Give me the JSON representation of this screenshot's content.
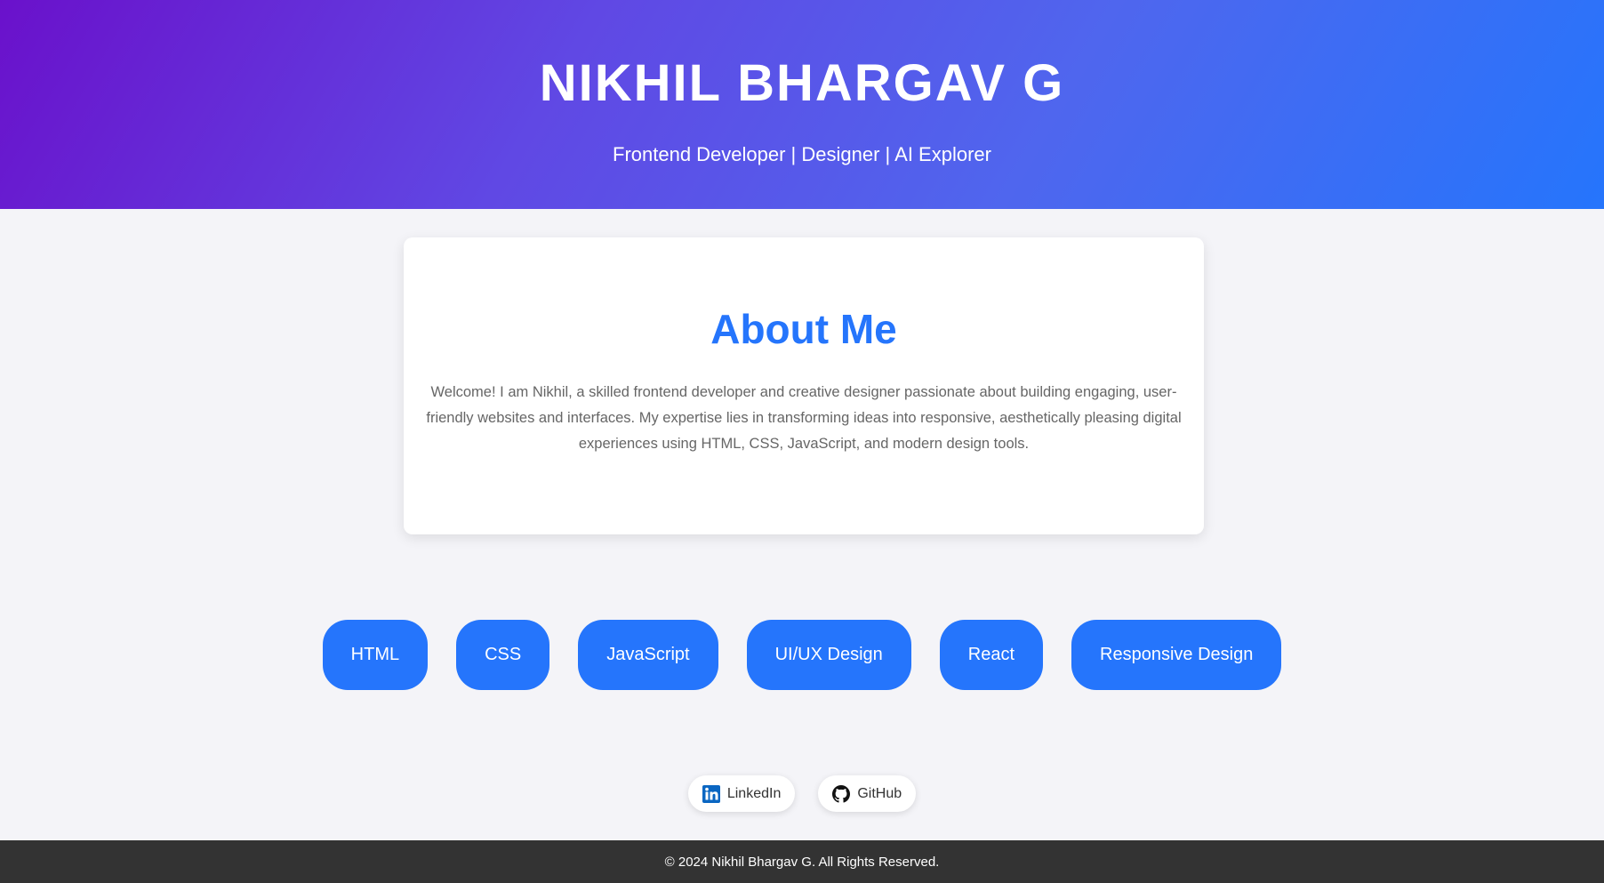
{
  "header": {
    "name": "NIKHIL BHARGAV G",
    "tagline": "Frontend Developer | Designer | AI Explorer"
  },
  "about": {
    "title": "About Me",
    "text": "Welcome! I am Nikhil, a skilled frontend developer and creative designer passionate about building engaging, user-friendly websites and interfaces. My expertise lies in transforming ideas into responsive, aesthetically pleasing digital experiences using HTML, CSS, JavaScript, and modern design tools."
  },
  "skills": [
    "HTML",
    "CSS",
    "JavaScript",
    "UI/UX Design",
    "React",
    "Responsive Design"
  ],
  "social": [
    {
      "label": "LinkedIn",
      "icon": "linkedin-icon"
    },
    {
      "label": "GitHub",
      "icon": "github-icon"
    }
  ],
  "footer": {
    "text": "© 2024 Nikhil Bhargav G. All Rights Reserved."
  },
  "colors": {
    "accent": "#2575fc",
    "gradient_start": "#6a11cb",
    "gradient_end": "#2575fc",
    "footer_bg": "#333333"
  }
}
